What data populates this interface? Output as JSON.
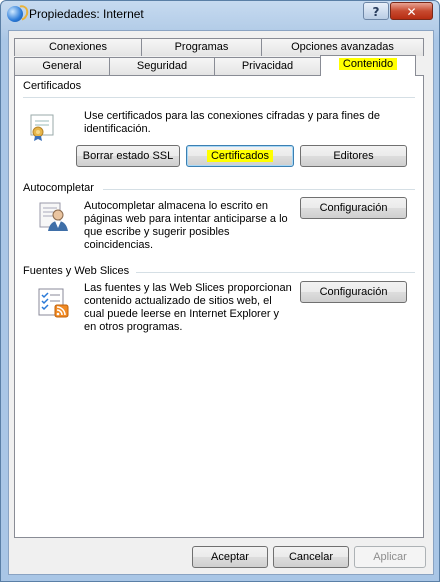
{
  "window": {
    "title": "Propiedades: Internet",
    "help_glyph": "?",
    "close_glyph": "✕"
  },
  "tabs_row1": [
    {
      "label": "Conexiones"
    },
    {
      "label": "Programas"
    },
    {
      "label": "Opciones avanzadas"
    }
  ],
  "tabs_row2": [
    {
      "label": "General"
    },
    {
      "label": "Seguridad"
    },
    {
      "label": "Privacidad"
    },
    {
      "label": "Contenido",
      "active": true
    }
  ],
  "certificados": {
    "title": "Certificados",
    "description": "Use certificados para las conexiones cifradas y para fines de identificación.",
    "buttons": {
      "ssl": "Borrar estado SSL",
      "certificados": "Certificados",
      "editores": "Editores"
    }
  },
  "autocompletar": {
    "title": "Autocompletar",
    "description": "Autocompletar almacena lo escrito en páginas web para intentar anticiparse a lo que escribe y sugerir posibles coincidencias.",
    "button": "Configuración"
  },
  "fuentes": {
    "title": "Fuentes y Web Slices",
    "description": "Las fuentes y las Web Slices proporcionan contenido actualizado de sitios web, el cual puede leerse en Internet Explorer y en otros programas.",
    "button": "Configuración"
  },
  "footer": {
    "accept": "Aceptar",
    "cancel": "Cancelar",
    "apply": "Aplicar"
  },
  "colors": {
    "highlight": "#ffff00",
    "title_gradient": "#b4cde8",
    "close": "#c74a30"
  },
  "icons": [
    "internet-options-icon",
    "certificate-icon",
    "autocomplete-user-icon",
    "feeds-icon"
  ]
}
